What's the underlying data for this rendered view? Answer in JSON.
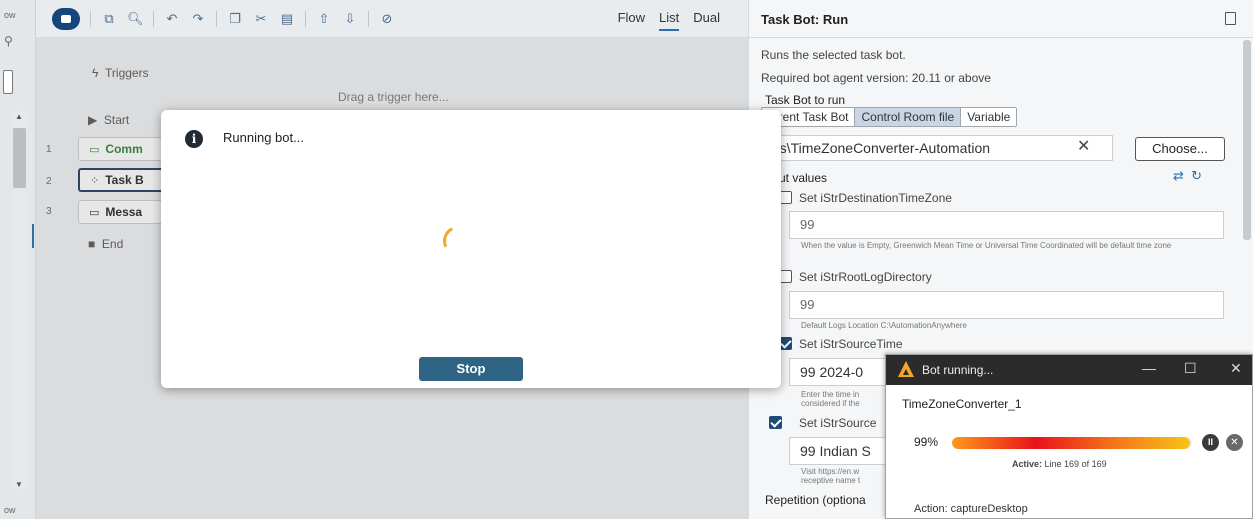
{
  "left_strip": {
    "top_label": "ow",
    "bottom_label": "ow"
  },
  "toolbar": {
    "view_tabs": [
      "Flow",
      "List",
      "Dual"
    ],
    "active_view": "List"
  },
  "flow": {
    "triggers_label": "Triggers",
    "drag_trigger_hint": "Drag a trigger here...",
    "start_label": "Start",
    "end_label": "End",
    "nodes": [
      {
        "num": "1",
        "label": "Comm"
      },
      {
        "num": "2",
        "label": "Task B"
      },
      {
        "num": "3",
        "label": "Messa"
      }
    ]
  },
  "modal": {
    "title": "Running bot...",
    "stop_label": "Stop"
  },
  "panel": {
    "title": "Task Bot: Run",
    "description": "Runs the selected task bot.",
    "version": "Required bot agent version: 20.11 or above",
    "bot_to_run_label": "Task Bot to run",
    "source_options": [
      "urrent Task Bot",
      "Control Room file",
      "Variable"
    ],
    "selected_source": "Control Room file",
    "file_path": "ots\\TimeZoneConverter-Automation",
    "choose_label": "Choose...",
    "input_values_label": "ut values",
    "fields": [
      {
        "label": "Set iStrDestinationTimeZone",
        "checked": false,
        "value": "99",
        "hint": "When the value is Empty, Greenwich Mean Time or Universal Time Coordinated will be default time zone"
      },
      {
        "label": "Set iStrRootLogDirectory",
        "checked": false,
        "value": "99",
        "hint": "Default Logs Location C:\\AutomationAnywhere"
      },
      {
        "label": "Set iStrSourceTime",
        "checked": true,
        "value": "99  2024-0",
        "hint": "Enter the time in\nconsidered if the"
      },
      {
        "label": "Set iStrSource",
        "checked": true,
        "value": "99  Indian S",
        "hint": "Visit https://en.w\nreceptive name t"
      }
    ],
    "repetition_label": "Repetition (optiona"
  },
  "bot_window": {
    "title": "Bot running...",
    "bot_name": "TimeZoneConverter_1",
    "progress_label": "99%",
    "progress": 0.99,
    "active_prefix": "Active:",
    "active_text": "Line 169 of 169",
    "action_text": "Action: captureDesktop"
  }
}
